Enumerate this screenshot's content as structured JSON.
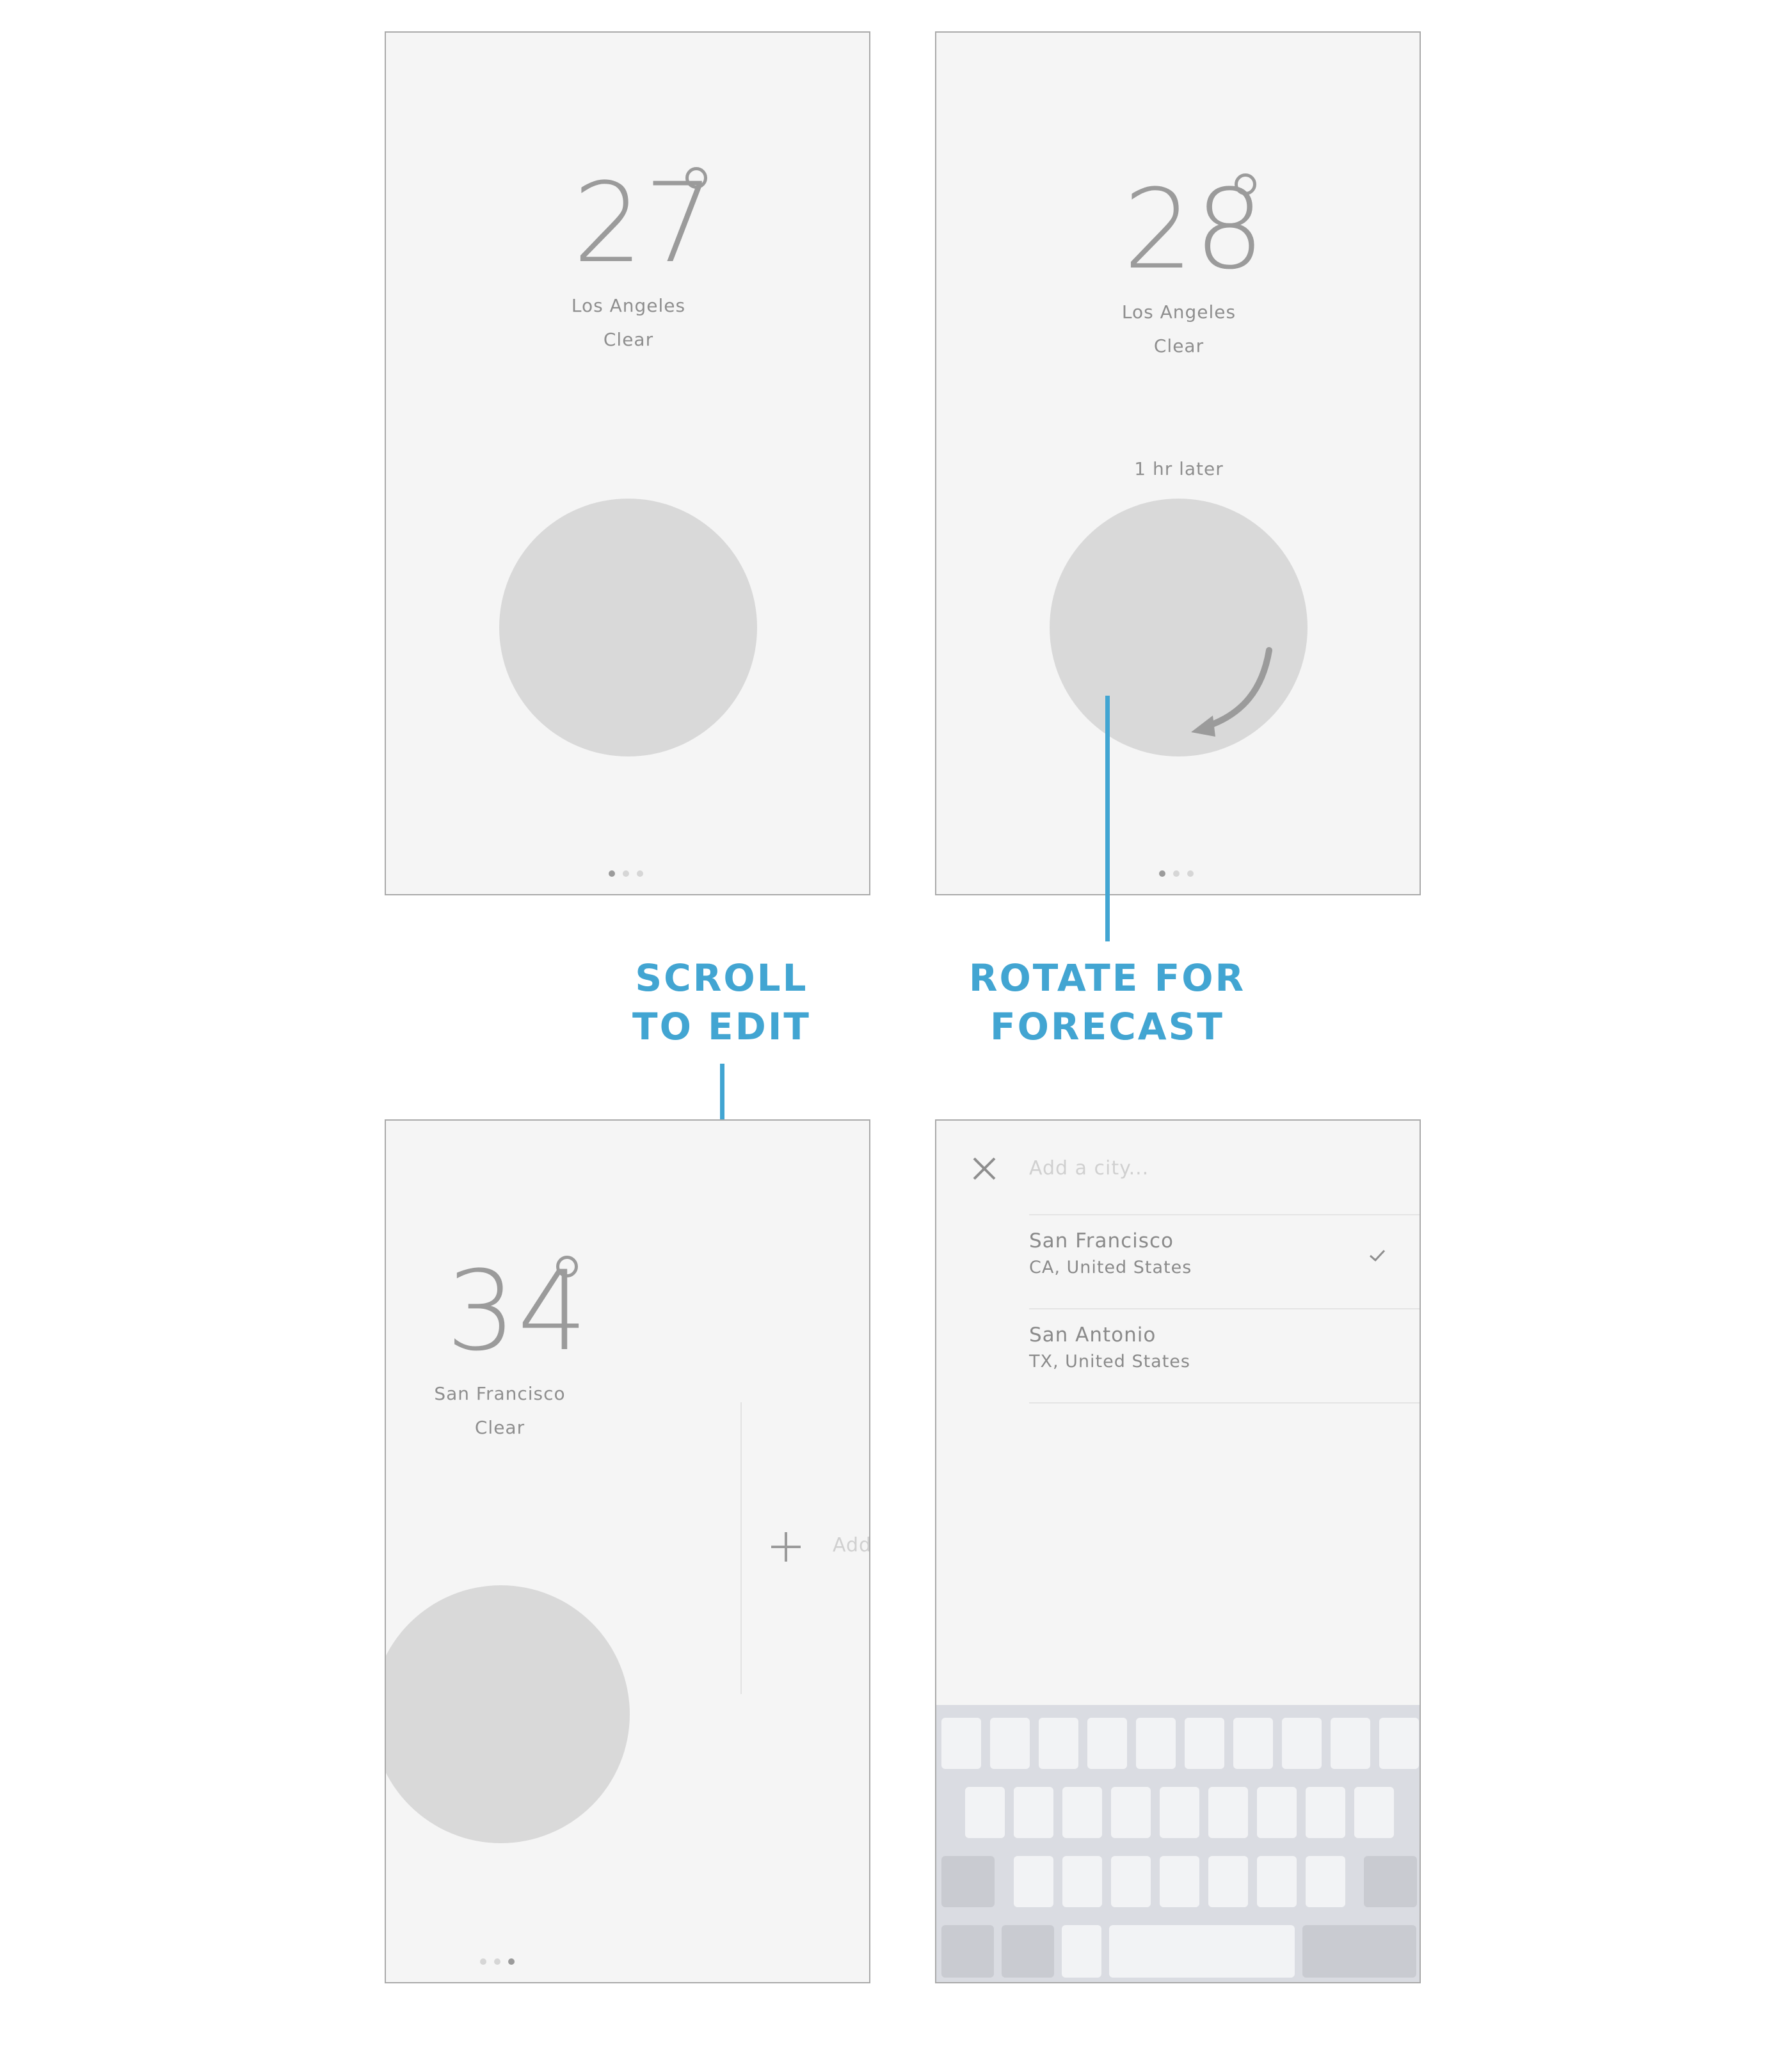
{
  "screen1": {
    "temperature": "27",
    "city": "Los Angeles",
    "condition": "Clear"
  },
  "screen2": {
    "temperature": "28",
    "city": "Los Angeles",
    "condition": "Clear",
    "forecast_time": "1 hr later"
  },
  "screen3": {
    "temperature": "34",
    "city": "San Francisco",
    "condition": "Clear",
    "add_label": "Add"
  },
  "screen4": {
    "search_placeholder": "Add a city...",
    "results": [
      {
        "name": "San Francisco",
        "region": "CA, United States",
        "selected": true
      },
      {
        "name": "San Antonio",
        "region": "TX, United States",
        "selected": false
      }
    ]
  },
  "callouts": {
    "scroll": [
      "SCROLL",
      "TO EDIT"
    ],
    "rotate": [
      "ROTATE FOR",
      "FORECAST"
    ]
  },
  "colors": {
    "accent": "#42a5d2",
    "screen_bg": "#f5f5f5",
    "circle": "#d9d9d9",
    "text_grey": "#9b9b9b"
  },
  "icons": {
    "close": "close-icon",
    "check": "check-icon",
    "plus": "plus-icon",
    "rotate_arrow": "rotate-arrow-icon"
  }
}
